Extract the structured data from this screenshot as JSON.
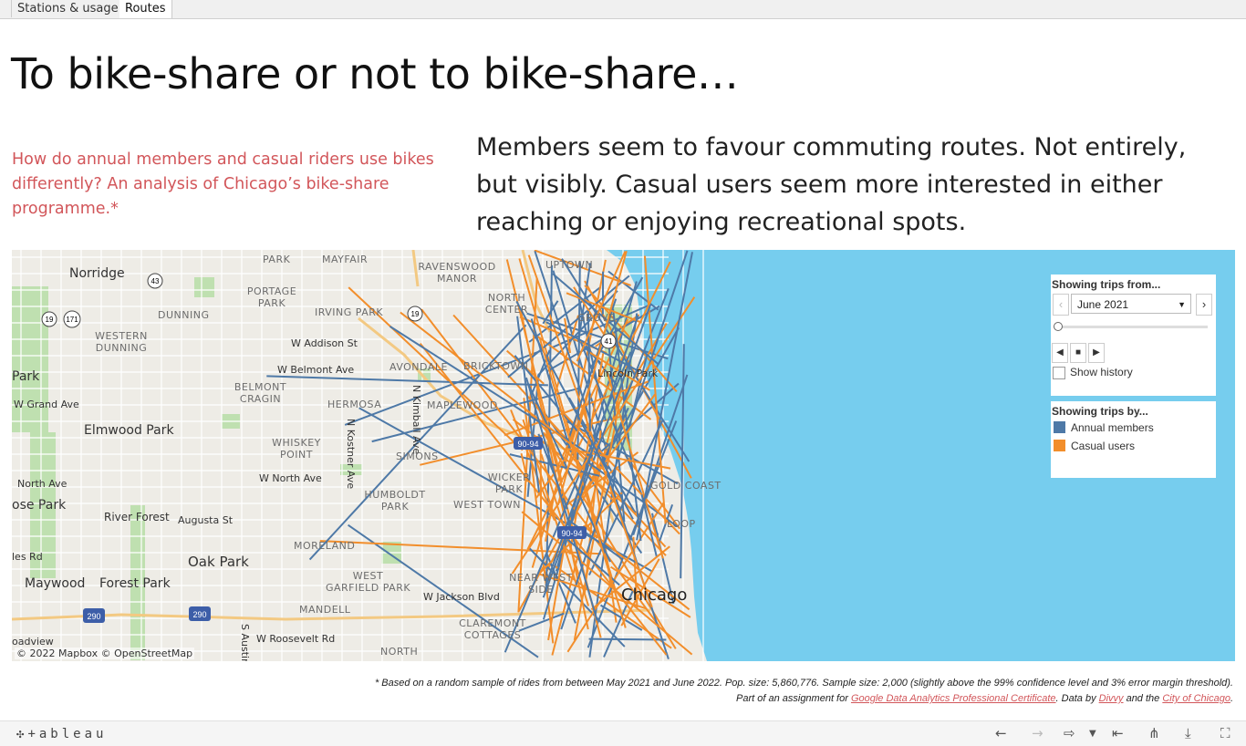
{
  "tabs": [
    {
      "label": "Stations & usage",
      "active": false
    },
    {
      "label": "Routes",
      "active": true
    }
  ],
  "title": "To bike-share or not to bike-share…",
  "subtitle": "How do annual members and casual riders use bikes differently? An analysis of Chicago’s bike-share programme.*",
  "insight": "Members seem to favour commuting routes. Not entirely, but visibly. Casual users seem more interested in either reaching or enjoying recreational spots.",
  "map": {
    "water_color": "#76cdee",
    "land_color": "#eeece6",
    "places": {
      "norridge": "Norridge",
      "mayfair": "MAYFAIR",
      "park_top": "PARK",
      "ravenswood": "RAVENSWOOD MANOR",
      "uptown": "UPTOWN",
      "portage": "PORTAGE PARK",
      "north_center": "NORTH CENTER",
      "dunning": "DUNNING",
      "irving": "IRVING PARK",
      "lincoln_sq": "OLN SQUARE",
      "grove": "GROVE",
      "western_dunning": "WESTERN DUNNING",
      "addison": "W Addison St",
      "belmont": "W Belmont Ave",
      "avondale": "AVONDALE",
      "bricktown": "BRICKTOWN",
      "lincoln_park": "Lincoln Park",
      "park_left": "Park",
      "belmont_cragin": "BELMONT CRAGIN",
      "grand": "W Grand Ave",
      "hermosa": "HERMOSA",
      "kimball": "N Kimball Ave",
      "maplewood": "MAPLEWOOD",
      "elmwood": "Elmwood Park",
      "whiskey": "WHISKEY POINT",
      "kostner": "N Kostner Ave",
      "simons": "SIMONS",
      "north_ave": "North Ave",
      "w_north_ave": "W North Ave",
      "wicker": "WICKER PARK",
      "gold_coast": "GOLD COAST",
      "rose_park": "ose Park",
      "humboldt": "HUMBOLDT PARK",
      "west_town": "WEST TOWN",
      "river_forest": "River Forest",
      "augusta": "Augusta St",
      "loop": "LOOP",
      "moreland": "MORELAND",
      "les_rd": "les Rd",
      "oak_park": "Oak Park",
      "maywood": "Maywood",
      "forest_park": "Forest Park",
      "west_garfield": "WEST GARFIELD PARK",
      "near_west": "NEAR WEST SIDE",
      "mandell": "MANDELL",
      "jackson": "W Jackson Blvd",
      "chicago": "Chicago",
      "roadview": "oadview",
      "austin": "S Austin",
      "roosevelt": "W Roosevelt Rd",
      "claremont": "CLAREMONT COTTAGES",
      "north_lawndale": "NORTH"
    },
    "shields": {
      "i43": "43",
      "i19a": "19",
      "i171": "171",
      "i19b": "19",
      "i41": "41",
      "i9094a": "90-94",
      "i9094b": "90-94",
      "i290a": "290",
      "i290b": "290"
    },
    "attribution": "© 2022 Mapbox  © OpenStreetMap"
  },
  "filter_panel": {
    "title": "Showing trips from...",
    "selected_month": "June 2021",
    "prev_icon": "chevron-left-icon",
    "next_icon": "chevron-right-icon",
    "show_history_label": "Show history",
    "show_history_checked": false
  },
  "legend": {
    "title": "Showing trips by...",
    "items": [
      {
        "label": "Annual members",
        "color": "#4e79a7"
      },
      {
        "label": "Casual users",
        "color": "#f28e2b"
      }
    ]
  },
  "footnote": {
    "line1": "*  Based on a random sample of rides from between May 2021 and June 2022. Pop. size: 5,860,776. Sample size: 2,000 (slightly above the 99% confidence level and 3% error margin threshold).",
    "line2_prefix": "Part of an assignment for ",
    "link1": "Google Data Analytics Professional Certificate",
    "mid1": ". Data by ",
    "link2": "Divvy",
    "mid2": " and the ",
    "link3": "City of Chicago",
    "end": "."
  },
  "toolbar": {
    "logo": "+ableau"
  }
}
